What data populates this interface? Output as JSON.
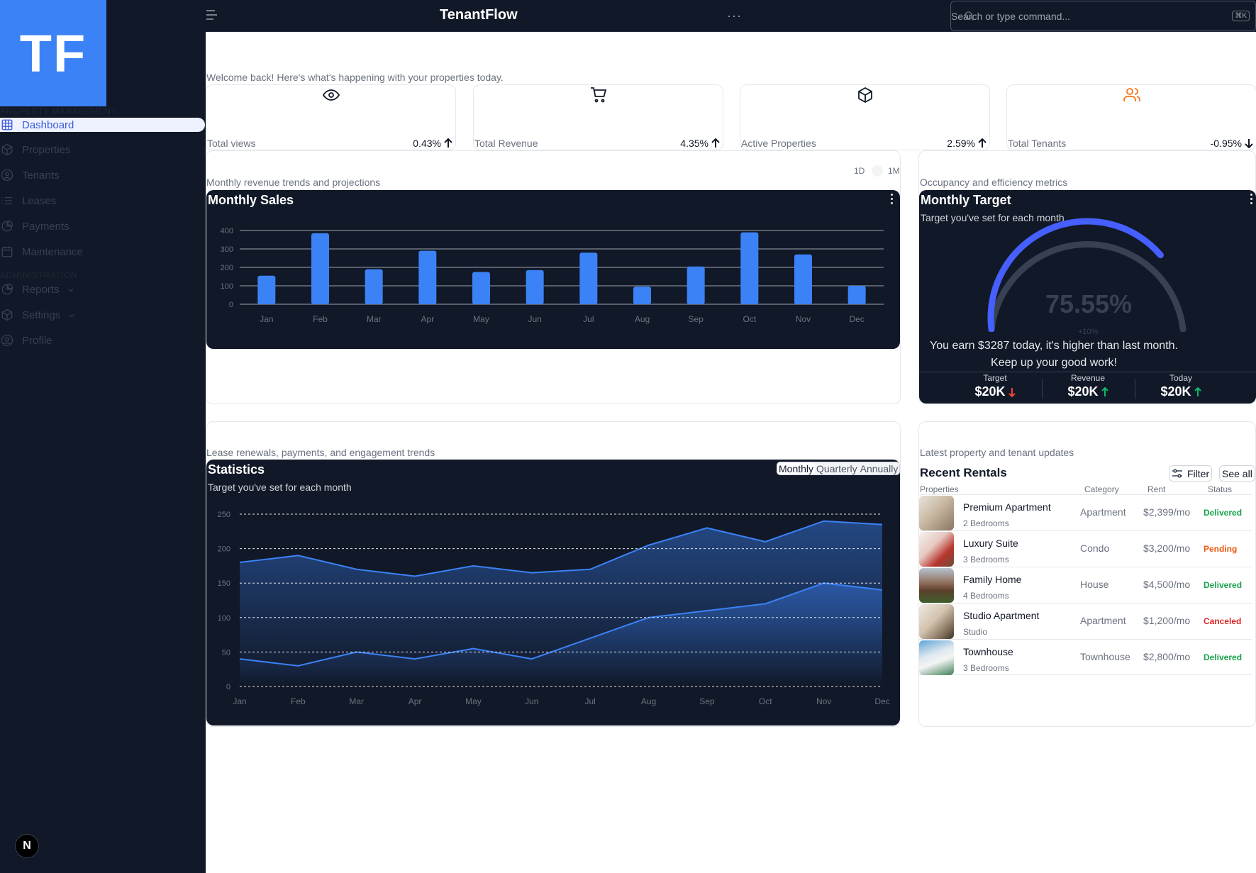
{
  "sidebar": {
    "logo_text": "TF",
    "section_property": "PROPERTY MANAGEMENT",
    "section_admin": "ADMINISTRATION",
    "items": [
      {
        "label": "Dashboard",
        "icon": "grid-icon"
      },
      {
        "label": "Properties",
        "icon": "box-icon"
      },
      {
        "label": "Tenants",
        "icon": "user-circle-icon"
      },
      {
        "label": "Leases",
        "icon": "list-icon"
      },
      {
        "label": "Payments",
        "icon": "pie-chart-icon"
      },
      {
        "label": "Maintenance",
        "icon": "calendar-icon"
      },
      {
        "label": "Reports",
        "icon": "pie-chart-icon"
      },
      {
        "label": "Settings",
        "icon": "box-icon"
      },
      {
        "label": "Profile",
        "icon": "user-circle-icon"
      }
    ],
    "badge": "N"
  },
  "topbar": {
    "brand": "TenantFlow",
    "more": "···",
    "search_placeholder": "Search or type command...",
    "shortcut": "⌘K"
  },
  "welcome": "Welcome back! Here's what's happening with your properties today.",
  "stats": [
    {
      "label": "Total views",
      "value": "0.43%",
      "trend": "up",
      "icon": "eye-icon"
    },
    {
      "label": "Total Revenue",
      "value": "4.35%",
      "trend": "up",
      "icon": "cart-icon"
    },
    {
      "label": "Active Properties",
      "value": "2.59%",
      "trend": "up",
      "icon": "box-icon"
    },
    {
      "label": "Total Tenants",
      "value": "-0.95%",
      "trend": "down",
      "icon": "users-icon"
    }
  ],
  "sales_section": {
    "subtitle": "Monthly revenue trends and projections",
    "seg_1d": "1D",
    "seg_1m": "1M",
    "title": "Monthly Sales"
  },
  "target_section": {
    "subtitle": "Occupancy and efficiency metrics",
    "title": "Monthly Target",
    "desc": "Target you've set for each month",
    "gauge_value": "75.55%",
    "gauge_fraction": 0.7555,
    "gauge_delta": "+10%",
    "earn_line1": "You earn $3287 today, it's higher than last month.",
    "earn_line2": "Keep up your good work!",
    "cols": [
      {
        "label": "Target",
        "value": "$20K",
        "trend": "down"
      },
      {
        "label": "Revenue",
        "value": "$20K",
        "trend": "up"
      },
      {
        "label": "Today",
        "value": "$20K",
        "trend": "up"
      }
    ],
    "colors": {
      "arc": "#465fff",
      "track": "#374151",
      "up": "#12b76a",
      "down": "#f04438"
    }
  },
  "stats_section": {
    "subtitle": "Lease renewals, payments, and engagement trends",
    "title": "Statistics",
    "desc": "Target you've set for each month",
    "tabs": [
      "Monthly",
      "Quarterly",
      "Annually"
    ]
  },
  "rentals_section": {
    "subtitle": "Latest property and tenant updates",
    "title": "Recent Rentals",
    "filter": "Filter",
    "see_all": "See all",
    "headers": [
      "Properties",
      "Category",
      "Rent",
      "Status"
    ],
    "rows": [
      {
        "name": "Premium Apartment",
        "sub": "2 Bedrooms",
        "category": "Apartment",
        "rent": "$2,399/mo",
        "status": "Delivered",
        "status_color": "#16a34a"
      },
      {
        "name": "Luxury Suite",
        "sub": "3 Bedrooms",
        "category": "Condo",
        "rent": "$3,200/mo",
        "status": "Pending",
        "status_color": "#ea580c"
      },
      {
        "name": "Family Home",
        "sub": "4 Bedrooms",
        "category": "House",
        "rent": "$4,500/mo",
        "status": "Delivered",
        "status_color": "#16a34a"
      },
      {
        "name": "Studio Apartment",
        "sub": "Studio",
        "category": "Apartment",
        "rent": "$1,200/mo",
        "status": "Canceled",
        "status_color": "#dc2626"
      },
      {
        "name": "Townhouse",
        "sub": "3 Bedrooms",
        "category": "Townhouse",
        "rent": "$2,800/mo",
        "status": "Delivered",
        "status_color": "#16a34a"
      }
    ]
  },
  "chart_data": [
    {
      "type": "bar",
      "title": "Monthly Sales",
      "categories": [
        "Jan",
        "Feb",
        "Mar",
        "Apr",
        "May",
        "Jun",
        "Jul",
        "Aug",
        "Sep",
        "Oct",
        "Nov",
        "Dec"
      ],
      "values": [
        155,
        385,
        190,
        290,
        175,
        185,
        280,
        95,
        205,
        390,
        270,
        100
      ],
      "ylim": [
        0,
        400
      ],
      "yticks": [
        0,
        100,
        200,
        300,
        400
      ],
      "grid": true,
      "color": "#3b82f6"
    },
    {
      "type": "area",
      "title": "Statistics",
      "categories": [
        "Jan",
        "Feb",
        "Mar",
        "Apr",
        "May",
        "Jun",
        "Jul",
        "Aug",
        "Sep",
        "Oct",
        "Nov",
        "Dec"
      ],
      "series": [
        {
          "values": [
            180,
            190,
            170,
            160,
            175,
            165,
            170,
            205,
            230,
            210,
            240,
            235
          ]
        },
        {
          "values": [
            40,
            30,
            50,
            40,
            55,
            40,
            70,
            100,
            110,
            120,
            150,
            140
          ]
        }
      ],
      "ylim": [
        0,
        250
      ],
      "yticks": [
        0,
        50,
        100,
        150,
        200,
        250
      ],
      "grid": true,
      "color": "#3b82f6"
    }
  ]
}
